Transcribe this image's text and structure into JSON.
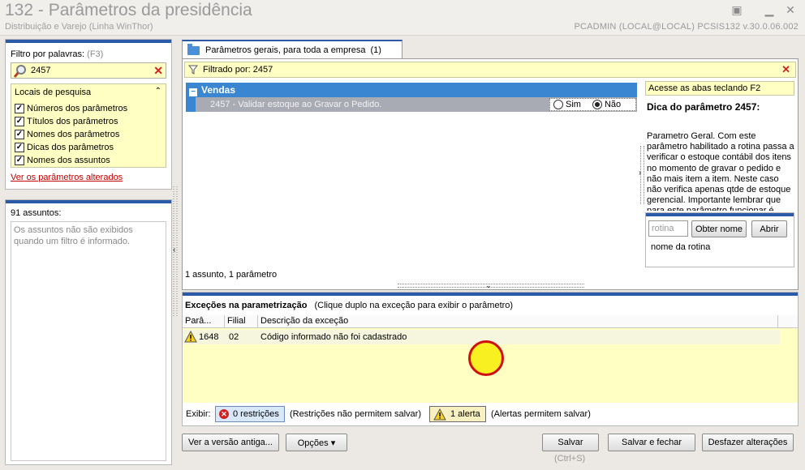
{
  "window": {
    "title": "132 - Parâmetros da presidência",
    "subtitle": "Distribuição e Varejo (Linha WinThor)",
    "user_info": "PCADMIN (LOCAL@LOCAL)   PCSIS132  v.30.0.06.002"
  },
  "filter": {
    "label": "Filtro por palavras:",
    "shortcut": "(F3)",
    "value": "2457",
    "locais_title": "Locais de pesquisa",
    "options": [
      {
        "label": "Números dos parâmetros",
        "checked": true
      },
      {
        "label": "Títulos dos parâmetros",
        "checked": true
      },
      {
        "label": "Nomes dos parâmetros",
        "checked": true
      },
      {
        "label": "Dicas dos parâmetros",
        "checked": true
      },
      {
        "label": "Nomes dos assuntos",
        "checked": true
      }
    ],
    "altered_link": "Ver os parâmetros alterados"
  },
  "assuntos": {
    "count": "91 assuntos:",
    "message": "Os assuntos não são exibidos quando um filtro é informado."
  },
  "tab": {
    "label": "Parâmetros gerais, para toda a empresa",
    "count": "(1)"
  },
  "main": {
    "filtered": "Filtrado por: 2457",
    "group": "Vendas",
    "param_text": "2457 - Validar estoque ao Gravar o Pedido.",
    "radio_sim": "Sim",
    "radio_nao": "Não",
    "radio_selected": "Não",
    "status": "1 assunto, 1 parâmetro"
  },
  "tip": {
    "f2": "Acesse as abas teclando F2",
    "title": "Dica do parâmetro 2457:",
    "text": "Parametro Geral. Com este parâmetro habilitado a rotina passa a verificar o estoque contábil dos itens no momento de gravar o pedido e não mais item a item. Neste caso não verifica apenas qtde de estoque gerencial. Importante lembrar que para este parâmetro funcionar é",
    "rotina_placeholder": "rotina",
    "obter_nome": "Obter nome",
    "abrir": "Abrir",
    "nome_rotina": "nome da rotina"
  },
  "exceptions": {
    "title": "Exceções na parametrização",
    "hint": "(Clique duplo na exceção para exibir o parâmetro)",
    "columns": [
      "Parâ...",
      "Filial",
      "Descrição da exceção"
    ],
    "rows": [
      {
        "param": "1648",
        "filial": "02",
        "descricao": "Código informado não foi cadastrado"
      }
    ],
    "exibir": "Exibir:",
    "restricoes": "0 restrições",
    "restricoes_note": "(Restrições não permitem salvar)",
    "alertas": "1 alerta",
    "alertas_note": "(Alertas permitem salvar)"
  },
  "buttons": {
    "versao": "Ver a versão antiga...",
    "opcoes": "Opções",
    "salvar": "Salvar",
    "salvar_hint": "(Ctrl+S)",
    "salvar_fechar": "Salvar e fechar",
    "desfazer": "Desfazer alterações"
  },
  "colors": {
    "accent": "#2a5aa8",
    "group_header": "#3a86d0",
    "highlight": "#ffffc4",
    "error": "#d02020"
  }
}
